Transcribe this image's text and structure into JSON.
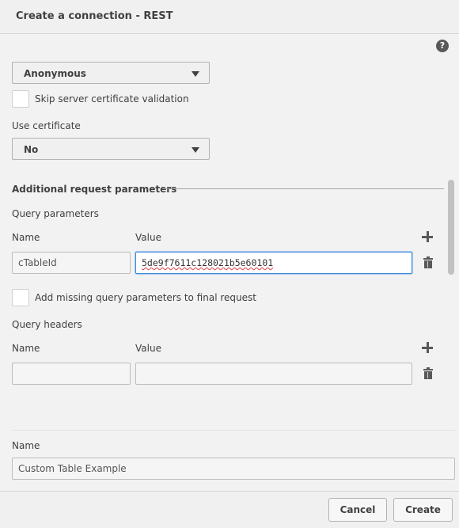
{
  "dialog": {
    "title": "Create a connection - REST",
    "help_icon": "question-circle-icon"
  },
  "auth": {
    "selected": "Anonymous"
  },
  "skip_cert": {
    "label": "Skip server certificate validation",
    "checked": false
  },
  "use_certificate": {
    "label": "Use certificate",
    "selected": "No"
  },
  "additional": {
    "title": "Additional request parameters"
  },
  "query_params": {
    "title": "Query parameters",
    "name_header": "Name",
    "value_header": "Value",
    "rows": [
      {
        "name": "cTableId",
        "value": "5de9f7611c128021b5e60101"
      }
    ]
  },
  "add_missing": {
    "label": "Add missing query parameters to final request",
    "checked": false
  },
  "query_headers": {
    "title": "Query headers",
    "name_header": "Name",
    "value_header": "Value",
    "rows": [
      {
        "name": "",
        "value": ""
      }
    ]
  },
  "connection_name": {
    "label": "Name",
    "value": "Custom Table Example"
  },
  "footer": {
    "cancel_label": "Cancel",
    "create_label": "Create"
  }
}
